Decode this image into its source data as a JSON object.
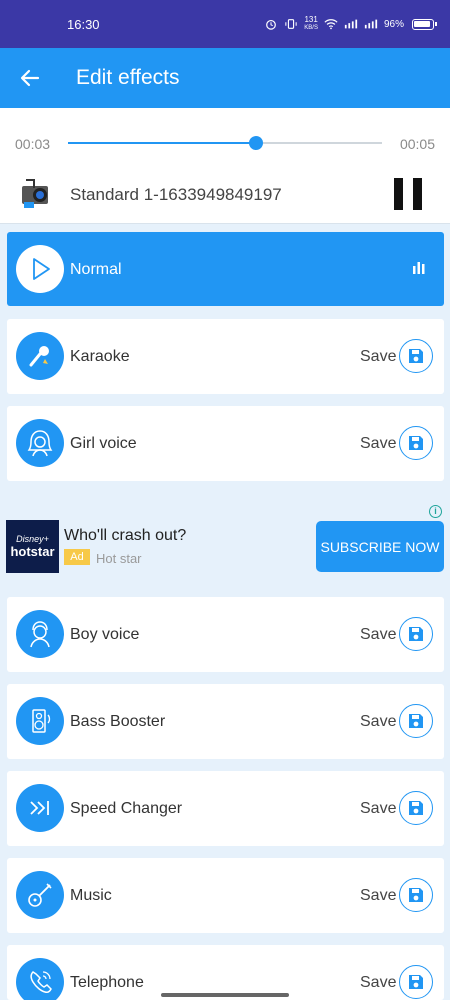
{
  "status_bar": {
    "time": "16:30",
    "net_speed": "131",
    "net_unit": "KB/S",
    "battery": "96%"
  },
  "app_bar": {
    "title": "Edit effects",
    "back_icon": "arrow-left-icon"
  },
  "player": {
    "current_time": "00:03",
    "total_time": "00:05",
    "progress": 0.6,
    "track_name": "Standard 1-1633949849197",
    "pause_icon": "pause-icon"
  },
  "effects": [
    {
      "label": "Normal",
      "icon": "play-icon",
      "selected": true
    },
    {
      "label": "Karaoke",
      "icon": "microphone-icon",
      "save": "Save"
    },
    {
      "label": "Girl voice",
      "icon": "girl-icon",
      "save": "Save"
    },
    {
      "label": "Boy voice",
      "icon": "boy-icon",
      "save": "Save"
    },
    {
      "label": "Bass Booster",
      "icon": "speaker-icon",
      "save": "Save"
    },
    {
      "label": "Speed Changer",
      "icon": "fast-forward-icon",
      "save": "Save"
    },
    {
      "label": "Music",
      "icon": "guitar-icon",
      "save": "Save"
    },
    {
      "label": "Telephone",
      "icon": "telephone-icon",
      "save": "Save"
    }
  ],
  "ad": {
    "logo_line1": "Disney+",
    "logo_line2": "hotstar",
    "title": "Who'll crash out?",
    "badge": "Ad",
    "advertiser": "Hot star",
    "cta": "SUBSCRIBE NOW"
  },
  "colors": {
    "primary": "#2196f3",
    "status_bar": "#3b38a6",
    "background": "#e6f1fb"
  }
}
